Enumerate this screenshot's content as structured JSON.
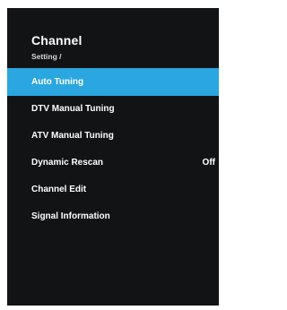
{
  "header": {
    "title": "Channel",
    "breadcrumb": "Setting /"
  },
  "menu": {
    "selected_color": "#2aa6e0",
    "items": [
      {
        "label": "Auto Tuning",
        "value": "",
        "selected": true
      },
      {
        "label": "DTV Manual Tuning",
        "value": ""
      },
      {
        "label": "ATV Manual Tuning",
        "value": ""
      },
      {
        "label": "Dynamic Rescan",
        "value": "Off"
      },
      {
        "label": "Channel Edit",
        "value": ""
      },
      {
        "label": "Signal Information",
        "value": ""
      }
    ]
  }
}
